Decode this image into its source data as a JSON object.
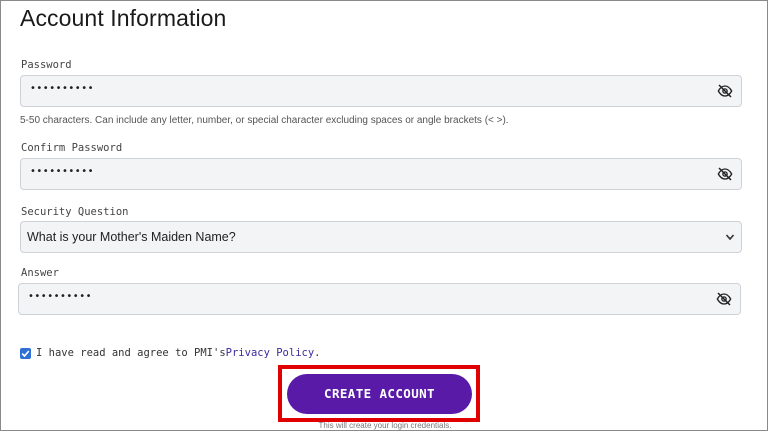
{
  "title": "Account Information",
  "password": {
    "label": "Password",
    "value": "••••••••••",
    "toggle_icon": "eye-slash-icon",
    "helper": "5-50 characters. Can include any letter, number, or special character excluding spaces or angle brackets (< >)."
  },
  "confirm_password": {
    "label": "Confirm Password",
    "value": "••••••••••",
    "toggle_icon": "eye-slash-icon"
  },
  "security_question": {
    "label": "Security Question",
    "selected": "What is your Mother's Maiden Name?",
    "icon": "chevron-down-icon"
  },
  "answer": {
    "label": "Answer",
    "value": "••••••••••",
    "toggle_icon": "eye-slash-icon"
  },
  "agreement": {
    "checked": true,
    "text": "I have read and agree to PMI's ",
    "link": "Privacy Policy",
    "suffix": "."
  },
  "create_button": {
    "label": "CREATE ACCOUNT",
    "color": "#5a1aa8",
    "highlight_color": "#e00000"
  },
  "fine_print": "This will create your login credentials."
}
